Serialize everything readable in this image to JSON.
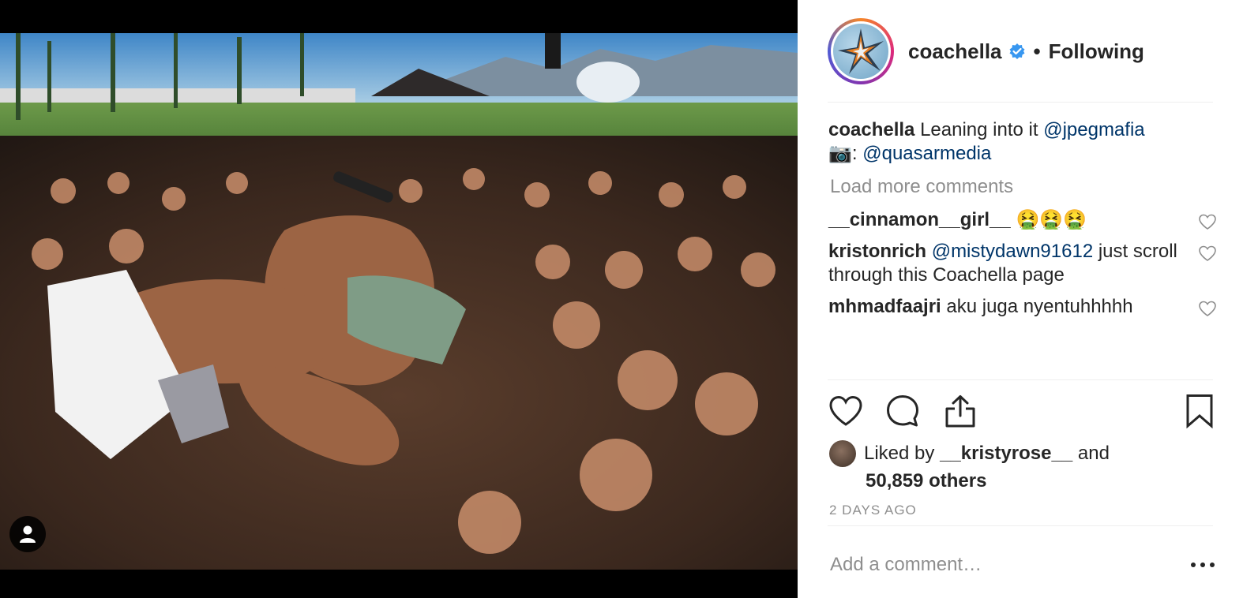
{
  "post": {
    "username": "coachella",
    "follow_status": "Following",
    "separator": "•",
    "caption": {
      "author": "coachella",
      "text": "Leaning into it",
      "mention": "@jpegmafia",
      "camera_emoji": "📷",
      "credit_prefix": ":",
      "credit_mention": "@quasarmedia"
    },
    "load_more_label": "Load more comments",
    "comments": [
      {
        "author": "__cinnamon__girl__",
        "mention": "",
        "text": "🤮🤮🤮"
      },
      {
        "author": "kristonrich",
        "mention": "@mistydawn91612",
        "text": "just scroll through this Coachella page"
      },
      {
        "author": "mhmadfaajri",
        "mention": "",
        "text": "aku juga nyentuhhhhh"
      }
    ],
    "likes": {
      "prefix": "Liked by",
      "liker": "__kristyrose__",
      "conjunction": "and",
      "count_label": "50,859 others"
    },
    "timestamp": "2 DAYS AGO",
    "add_comment_placeholder": "Add a comment…"
  },
  "icons": {
    "verified": "verified-badge-icon",
    "like": "heart-icon",
    "comment": "comment-bubble-icon",
    "share": "share-icon",
    "save": "bookmark-icon",
    "more": "more-options-icon",
    "user_tag": "person-icon"
  },
  "colors": {
    "verified_blue": "#3897f0",
    "mention_blue": "#003569",
    "muted_gray": "#8e8e8e",
    "text_dark": "#262626"
  }
}
